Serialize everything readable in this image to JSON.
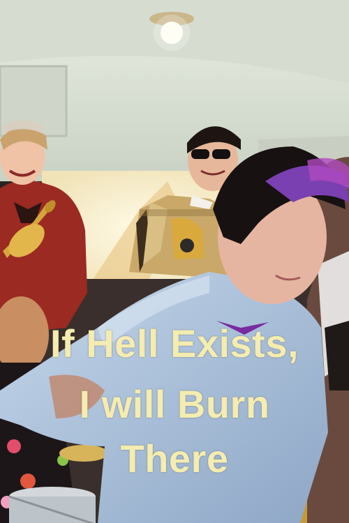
{
  "poster": {
    "title_lines": [
      "If Hell Exists,",
      "I will Burn",
      "There"
    ]
  },
  "colors": {
    "title_text": "#f4ecb0",
    "ceiling": "#dfe6dc",
    "shirt": "#a9c0dc",
    "dress": "#9a2a22"
  },
  "scene": {
    "description_icons": [
      "ceiling-lamp-icon",
      "trumpet-icon",
      "drum-icon"
    ]
  }
}
